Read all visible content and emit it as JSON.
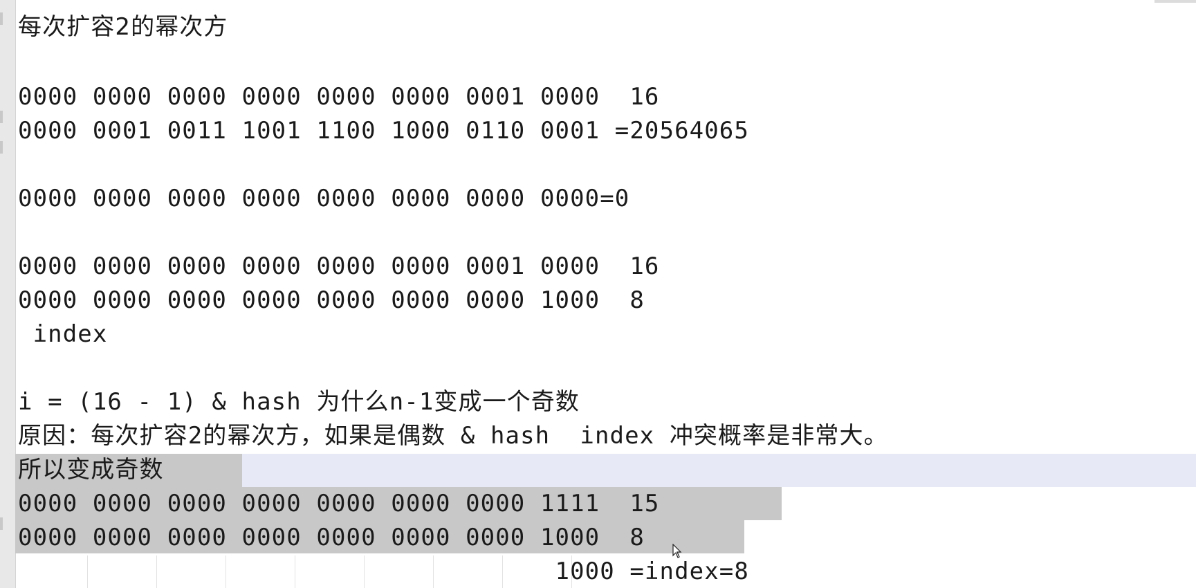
{
  "editor": {
    "lines": [
      "每次扩容2的幂次方",
      "",
      "0000 0000 0000 0000 0000 0000 0001 0000  16",
      "0000 0001 0011 1001 1100 1000 0110 0001 =20564065",
      "",
      "0000 0000 0000 0000 0000 0000 0000 0000=0",
      "",
      "0000 0000 0000 0000 0000 0000 0001 0000  16",
      "0000 0000 0000 0000 0000 0000 0000 1000  8",
      " index",
      "",
      "i = (16 - 1) & hash 为什么n-1变成一个奇数",
      "原因：每次扩容2的幂次方，如果是偶数 & hash  index 冲突概率是非常大。",
      "所以变成奇数",
      "0000 0000 0000 0000 0000 0000 0000 1111  15",
      "0000 0000 0000 0000 0000 0000 0000 1000  8",
      "                                    1000 =index=8"
    ]
  },
  "colors": {
    "background": "#ffffff",
    "gutter": "#e8e8e8",
    "current_line": "#e7e9f7",
    "selection": "#c8c8c8",
    "text": "#1a1a1a"
  },
  "icons": {
    "mouse_pointer": "mouse-pointer-icon"
  }
}
